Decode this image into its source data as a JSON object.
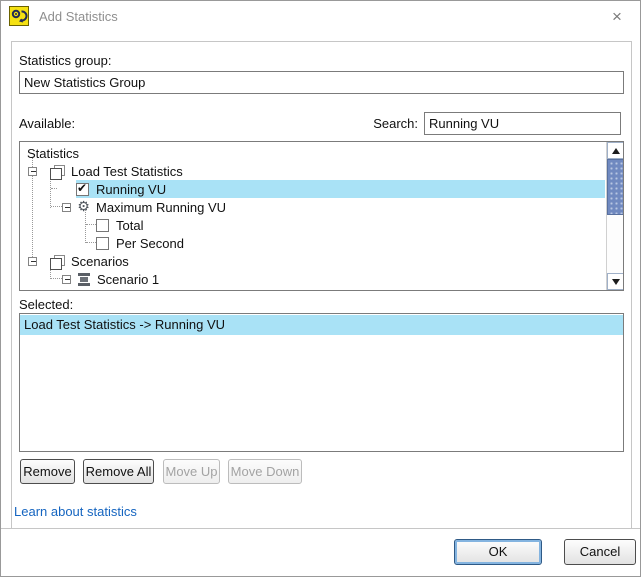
{
  "window": {
    "title": "Add Statistics",
    "close_glyph": "×"
  },
  "form": {
    "statistics_group_label": "Statistics group:",
    "statistics_group_value": "New Statistics Group",
    "available_label": "Available:",
    "search_label": "Search:",
    "search_value": "Running VU"
  },
  "tree": {
    "header": "Statistics",
    "nodes": [
      {
        "label": "Load Test Statistics",
        "level": 1,
        "icon": "report",
        "expanded": true
      },
      {
        "label": "Running VU",
        "level": 2,
        "checkbox": "checked",
        "highlighted": true
      },
      {
        "label": "Maximum Running VU",
        "level": 2,
        "icon": "gear",
        "expanded": true
      },
      {
        "label": "Total",
        "level": 3,
        "checkbox": "unchecked"
      },
      {
        "label": "Per Second",
        "level": 3,
        "checkbox": "unchecked"
      },
      {
        "label": "Scenarios",
        "level": 1,
        "icon": "report",
        "expanded": true
      },
      {
        "label": "Scenario 1",
        "level": 2,
        "icon": "scenario",
        "expanded": true
      }
    ]
  },
  "selected": {
    "label": "Selected:",
    "items": [
      {
        "label": "Load Test Statistics -> Running VU",
        "highlighted": true
      }
    ]
  },
  "list_buttons": {
    "remove": "Remove",
    "remove_all": "Remove All",
    "move_up": "Move Up",
    "move_down": "Move Down"
  },
  "link": {
    "label": "Learn about statistics"
  },
  "footer": {
    "ok": "OK",
    "cancel": "Cancel"
  },
  "colors": {
    "selection_highlight": "#a9e2f6",
    "link": "#1565c0",
    "app_icon_bg": "#f5e112",
    "scrollbar_thumb": "#7089c0"
  }
}
